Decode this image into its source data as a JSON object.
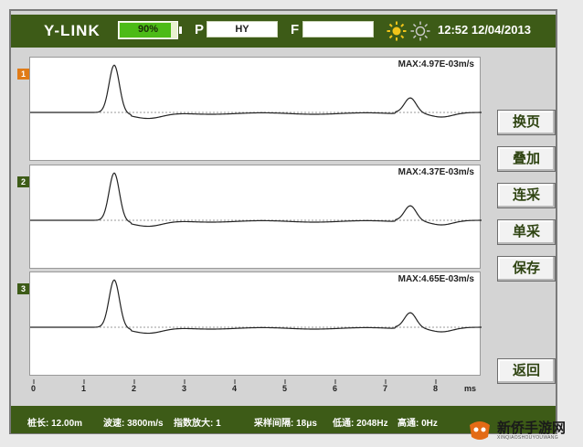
{
  "header": {
    "brand": "Y-LINK",
    "battery": 0.9,
    "battery_label": "90%",
    "p_label": "P",
    "p_value": "HY",
    "f_label": "F",
    "f_value": "",
    "datetime": "12:52 12/04/2013"
  },
  "channels": [
    {
      "num": "1",
      "max": "MAX:4.97E-03m/s",
      "badge_color": "#e07b17"
    },
    {
      "num": "2",
      "max": "MAX:4.37E-03m/s",
      "badge_color": "#3d5b17"
    },
    {
      "num": "3",
      "max": "MAX:4.65E-03m/s",
      "badge_color": "#3d5b17"
    }
  ],
  "axis": {
    "ticks": [
      "0",
      "1",
      "2",
      "3",
      "4",
      "5",
      "6",
      "7",
      "8"
    ],
    "unit": "ms"
  },
  "buttons": {
    "page": "换页",
    "overlay": "叠加",
    "continuous": "连采",
    "single": "单采",
    "save": "保存",
    "back": "返回"
  },
  "status": {
    "length": "桩长: 12.00m",
    "wave_speed": "波速: 3800m/s",
    "gain": "指数放大: 1",
    "sample_interval": "采样间隔: 18μs",
    "lowpass": "低通: 2048Hz",
    "highpass": "高通: 0Hz"
  },
  "watermark": {
    "text": "新侨手游网",
    "sub": "XINQIAOSHOUYOUWANG"
  },
  "colors": {
    "bar": "#3d5b17",
    "accent": "#4cbb17",
    "sun": "#f0c419"
  }
}
